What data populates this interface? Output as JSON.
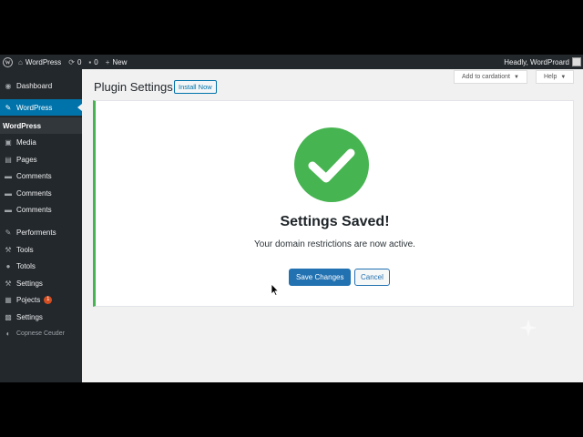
{
  "adminbar": {
    "site_name": "WordPress",
    "updates_count": "0",
    "comments_count": "0",
    "new_label": "New",
    "user_greeting": "Headly, WordProard"
  },
  "sidebar": {
    "items": [
      {
        "label": "Dashboard",
        "icon": "dashboard-icon"
      },
      {
        "label": "WordPress",
        "icon": "pin-icon",
        "active": true
      },
      {
        "label": "WordPress",
        "icon": "",
        "submenu": true
      },
      {
        "label": "Media",
        "icon": "media-icon"
      },
      {
        "label": "Pages",
        "icon": "pages-icon"
      },
      {
        "label": "Comments",
        "icon": "comments-icon"
      },
      {
        "label": "Comments",
        "icon": "comments-icon"
      },
      {
        "label": "Comments",
        "icon": "comments-icon"
      },
      {
        "label": "Performents",
        "icon": "pin-icon"
      },
      {
        "label": "Tools",
        "icon": "wrench-icon"
      },
      {
        "label": "Totols",
        "icon": "user-icon"
      },
      {
        "label": "Settings",
        "icon": "wrench-icon"
      },
      {
        "label": "Pojects",
        "icon": "plugin-icon",
        "badge": "1"
      },
      {
        "label": "Settings",
        "icon": "settings-icon"
      },
      {
        "label": "Copnese Ceuder",
        "icon": "collapse-icon"
      }
    ]
  },
  "header": {
    "title": "Plugin Settings",
    "install_button": "Install Now",
    "screen_options": "Add to cardationt",
    "help": "Help"
  },
  "notice": {
    "title": "Settings Saved!",
    "message": "Your domain restrictions are now active.",
    "save_button": "Save Changes",
    "cancel_button": "Cancel",
    "success_color": "#46b450",
    "accent_color": "#2271b1"
  }
}
